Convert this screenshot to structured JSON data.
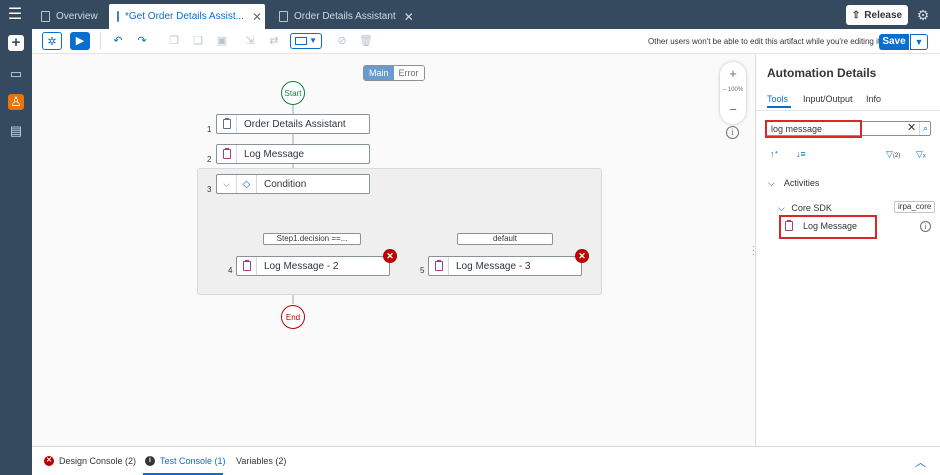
{
  "shell": {
    "tabs": [
      {
        "label": "Overview"
      },
      {
        "label": "*Get Order Details Assist..."
      },
      {
        "label": "Order Details Assistant"
      }
    ],
    "release_label": "Release"
  },
  "toolbar": {
    "lock_message": "Other users won't be able to edit this artifact while you're editing it.",
    "save_label": "Save"
  },
  "canvas": {
    "mode_main": "Main",
    "mode_error": "Error",
    "zoom_level": "100%",
    "start_label": "Start",
    "end_label": "End",
    "steps": [
      {
        "num": "1",
        "label": "Order Details Assistant"
      },
      {
        "num": "2",
        "label": "Log Message"
      },
      {
        "num": "3",
        "label": "Condition"
      },
      {
        "num": "4",
        "label": "Log Message - 2"
      },
      {
        "num": "5",
        "label": "Log Message - 3"
      }
    ],
    "branches": {
      "left": "Step1.decision ==...",
      "right": "default"
    }
  },
  "panel": {
    "title": "Automation Details",
    "tabs": [
      "Tools",
      "Input/Output",
      "Info"
    ],
    "search_value": "log message",
    "filter_count": "(2)",
    "section": "Activities",
    "subsection": "Core SDK",
    "package_tag": "irpa_core",
    "result_item": "Log Message"
  },
  "bottom": {
    "tabs": [
      "Design Console (2)",
      "Test Console (1)",
      "Variables (2)"
    ]
  },
  "colors": {
    "shell": "#354a5f",
    "accent": "#0a6ed1",
    "error": "#bb0000",
    "highlight": "#d9272e",
    "start_green": "#107e3e"
  }
}
